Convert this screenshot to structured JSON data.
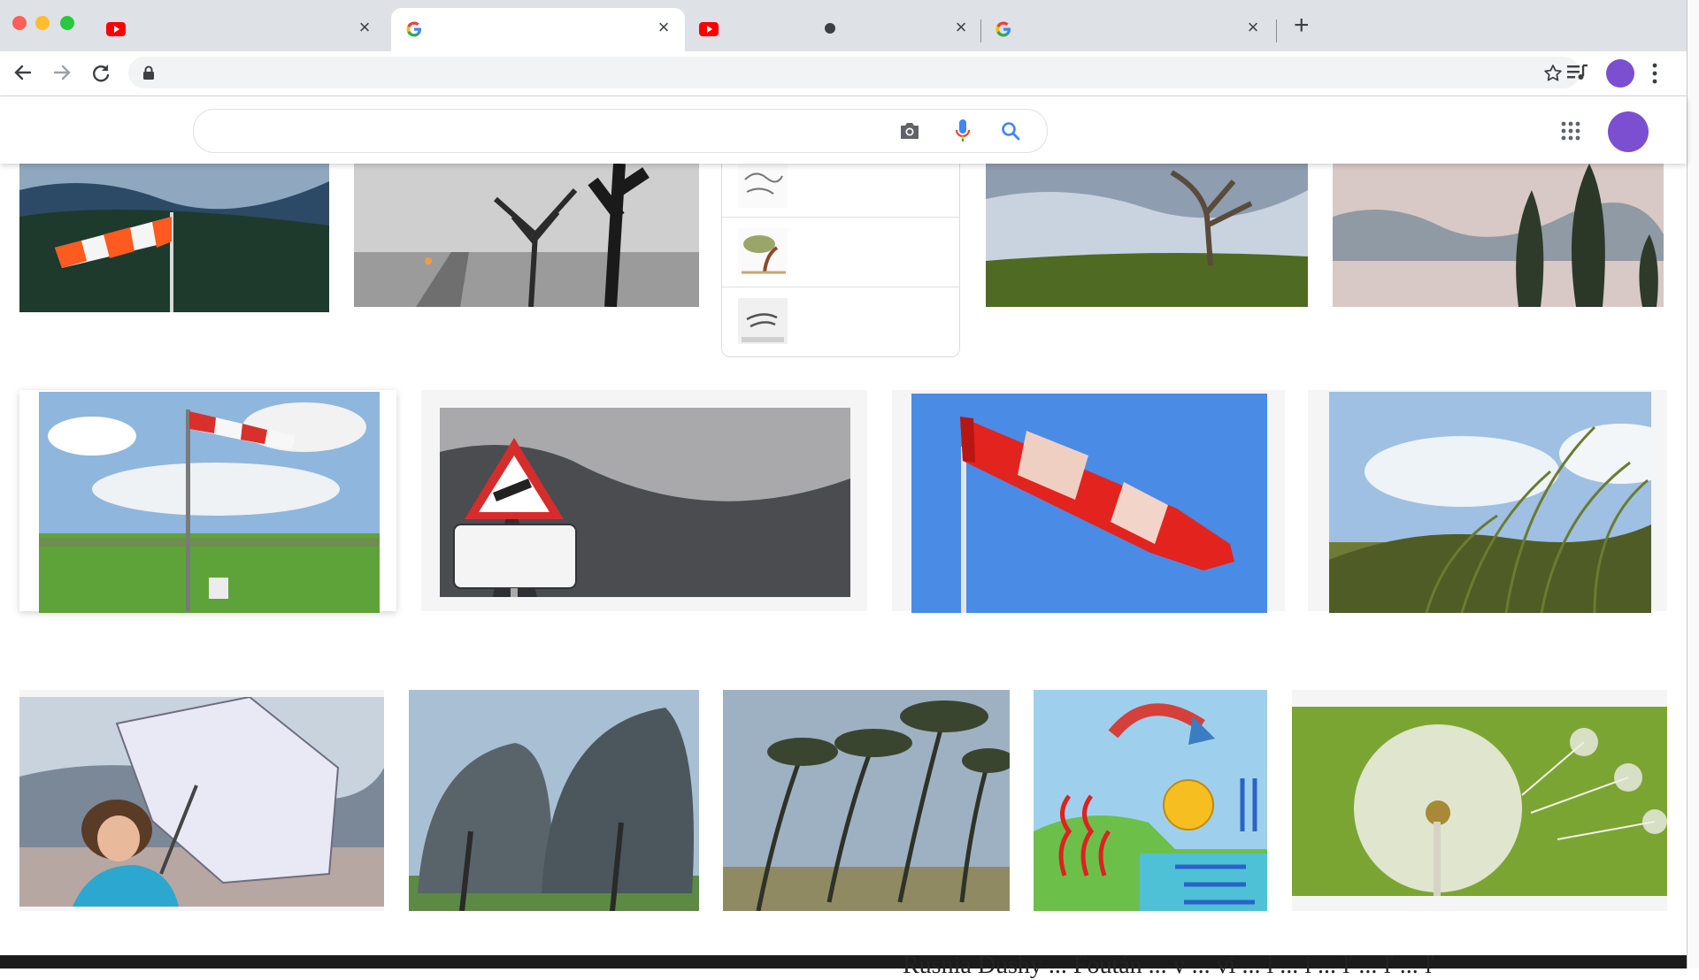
{
  "window": {
    "tabs": [
      {
        "favicon": "youtube-icon",
        "title": "",
        "active": false
      },
      {
        "favicon": "google-icon",
        "title": "",
        "active": true
      },
      {
        "favicon": "youtube-icon",
        "title": "",
        "active": false,
        "status": "audio-dot-icon"
      },
      {
        "favicon": "google-icon",
        "title": "",
        "active": false
      }
    ],
    "close_glyph": "×",
    "new_tab_glyph": "+"
  },
  "toolbar": {
    "url": "",
    "icons": [
      "back-arrow-icon",
      "forward-arrow-icon",
      "reload-icon",
      "lock-icon",
      "bookmark-star-icon",
      "media-queue-icon",
      "profile-avatar",
      "kebab-menu-icon"
    ]
  },
  "search": {
    "query": "",
    "icons": [
      "camera-search-icon",
      "microphone-icon",
      "search-magnifier-icon"
    ],
    "header_icons": [
      "apps-grid-icon",
      "account-avatar"
    ]
  },
  "results": {
    "row1": [
      "windsock-on-pole-mountains",
      "bare-trees-winter-road",
      "suggestions-popup",
      "windswept-tree-grassland",
      "cypress-trees-cloudy-sky"
    ],
    "popup_items": [
      "wind-sketch-thumbnail",
      "windblown-tree-thumbnail",
      "wind-icon-thumbnail"
    ],
    "row2": [
      "windsock-airfield",
      "wind-warning-sign",
      "windsock-blue-sky",
      "reeds-in-wind"
    ],
    "row3": [
      "woman-umbrella-wind",
      "trees-bent-by-wind",
      "pine-trees-coast",
      "wind-diagram",
      "dandelion-seeds"
    ]
  },
  "background_window": {
    "visible_text": "Rusnia Dushy ... Foután ... v ... vi ... l ... i ... ľ ... ľ ... ľ"
  },
  "colors": {
    "tab_strip": "#dee1e6",
    "avatar": "#7b4fd0",
    "google_blue": "#4285f4",
    "youtube_red": "#ff0000"
  }
}
